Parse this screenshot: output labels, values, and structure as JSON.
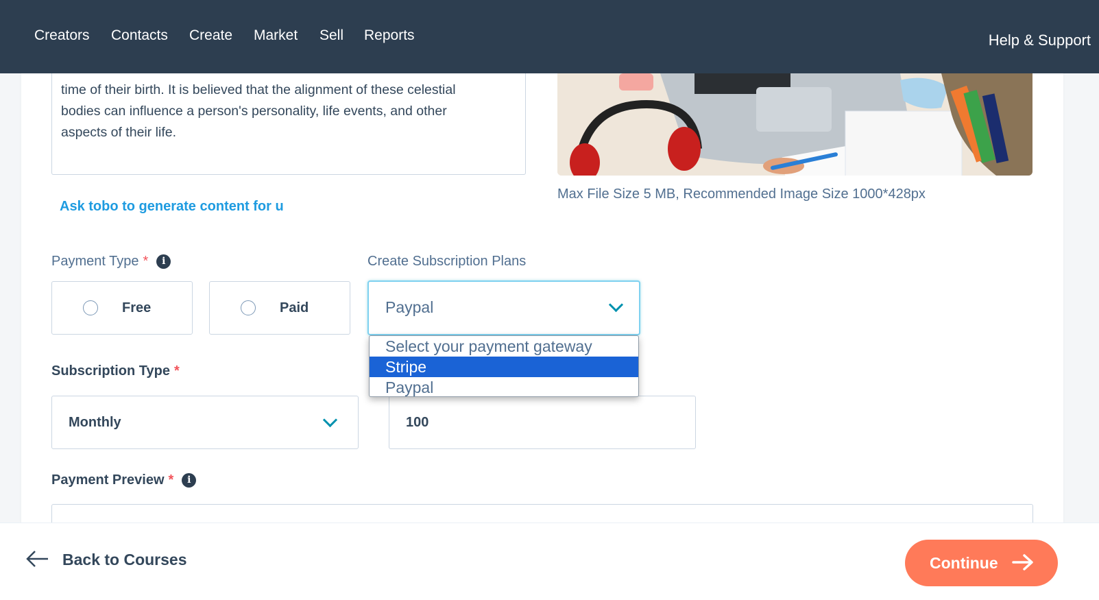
{
  "nav": {
    "items": [
      "Creators",
      "Contacts",
      "Create",
      "Market",
      "Sell",
      "Reports"
    ],
    "help": "Help & Support"
  },
  "description": {
    "lines": [
      "time of their birth. It is believed that the alignment of these celestial",
      "bodies can influence a person's personality, life events, and other",
      "aspects of their life."
    ]
  },
  "image": {
    "file_note": "Max File Size 5 MB, Recommended Image Size 1000*428px"
  },
  "ask_link": "Ask tobo to generate content for u",
  "payment_type": {
    "label": "Payment Type",
    "required": "*",
    "options": [
      "Free",
      "Paid"
    ]
  },
  "subscription_plans": {
    "label": "Create Subscription Plans",
    "selected": "Paypal",
    "dropdown_options": [
      "Select your payment gateway",
      "Stripe",
      "Paypal"
    ],
    "highlighted": "Stripe"
  },
  "subscription_type": {
    "label": "Subscription Type",
    "required": "*",
    "value": "Monthly",
    "amount": "100"
  },
  "payment_preview": {
    "label": "Payment Preview",
    "required": "*"
  },
  "footer": {
    "back": "Back to Courses",
    "continue": "Continue"
  },
  "colors": {
    "navbar": "#2d3e50",
    "link": "#1e9be0",
    "accent": "#ff7a59",
    "highlight": "#1a63d6"
  }
}
